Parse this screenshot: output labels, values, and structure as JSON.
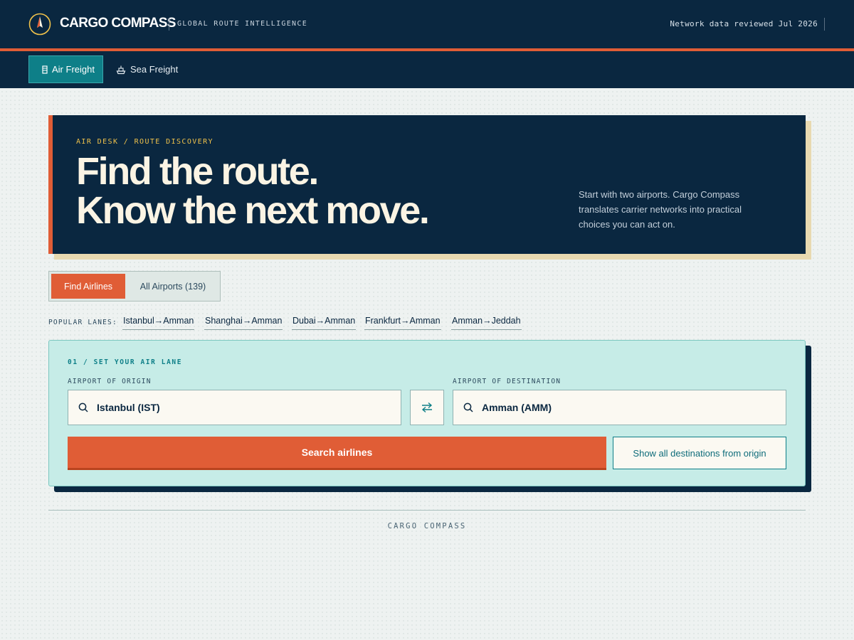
{
  "header": {
    "brand": "CARGO COMPASS",
    "tagline": "GLOBAL ROUTE INTELLIGENCE",
    "reviewed": "Network data reviewed Jul 2026"
  },
  "nav": {
    "tabs": [
      {
        "label": "Air Freight",
        "icon": "plane-icon",
        "active": true
      },
      {
        "label": "Sea Freight",
        "icon": "ship-icon",
        "active": false
      }
    ]
  },
  "hero": {
    "kicker": "AIR DESK / ROUTE DISCOVERY",
    "title_line1": "Find the route.",
    "title_line2": "Know the next move.",
    "description": "Start with two airports. Cargo Compass translates carrier networks into practical choices you can act on."
  },
  "mode": {
    "find_label": "Find Airlines",
    "all_label": "All Airports (139)"
  },
  "popular": {
    "label": "POPULAR LANES:",
    "lanes": [
      {
        "from": "Istanbul",
        "to": "Amman"
      },
      {
        "from": "Shanghai",
        "to": "Amman"
      },
      {
        "from": "Dubai",
        "to": "Amman"
      },
      {
        "from": "Frankfurt",
        "to": "Amman"
      },
      {
        "from": "Amman",
        "to": "Jeddah"
      }
    ]
  },
  "search": {
    "step": "01 / SET YOUR AIR LANE",
    "origin_label": "AIRPORT OF ORIGIN",
    "origin_value": "Istanbul (IST)",
    "destination_label": "AIRPORT OF DESTINATION",
    "destination_value": "Amman (AMM)",
    "search_button": "Search airlines",
    "alt_button": "Show all destinations from origin"
  },
  "footer": {
    "brand": "CARGO COMPASS"
  },
  "colors": {
    "navy": "#0a2740",
    "accent": "#e05d36",
    "teal": "#0e7f88",
    "mint": "#c6ece7",
    "cream": "#fbf4e4"
  }
}
